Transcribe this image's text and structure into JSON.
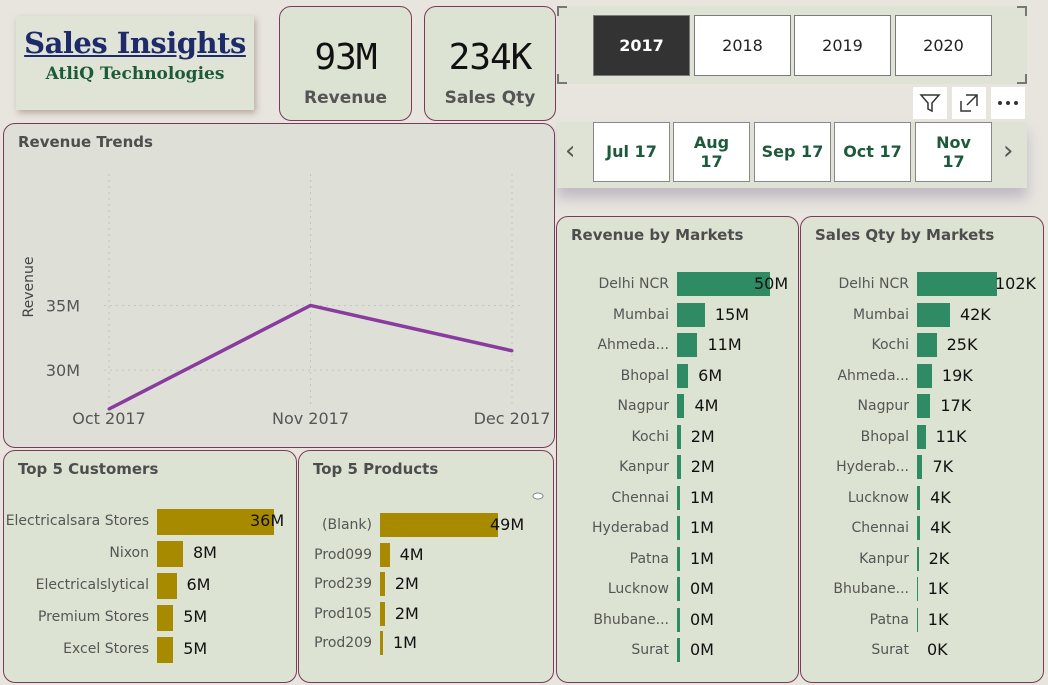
{
  "header": {
    "title": "Sales Insights",
    "subtitle": "AtliQ Technologies"
  },
  "kpis": [
    {
      "value": "93M",
      "label": "Revenue"
    },
    {
      "value": "234K",
      "label": "Sales Qty"
    }
  ],
  "year_slicer": {
    "options": [
      "2017",
      "2018",
      "2019",
      "2020"
    ],
    "selected": "2017"
  },
  "month_slicer": {
    "options": [
      "Jul 17",
      "Aug 17",
      "Sep 17",
      "Oct 17",
      "Nov 17"
    ]
  },
  "revenue_trends": {
    "title": "Revenue Trends",
    "chart_data": {
      "type": "line",
      "title": "Revenue Trends",
      "xlabel": "",
      "ylabel": "Revenue",
      "categories": [
        "Oct 2017",
        "Nov 2017",
        "Dec 2017"
      ],
      "values": [
        27,
        35,
        31.5
      ],
      "ytick_labels": [
        "35M",
        "30M"
      ],
      "ytick_values": [
        35,
        30
      ],
      "ylim": [
        27,
        35.5
      ],
      "grid": true,
      "color": "#8a3b9e"
    }
  },
  "top_customers": {
    "title": "Top 5 Customers",
    "chart_data": {
      "type": "bar",
      "categories": [
        "Electricalsara Stores",
        "Nixon",
        "Electricalslytical",
        "Premium Stores",
        "Excel Stores"
      ],
      "values": [
        36,
        8,
        6,
        5,
        5
      ],
      "labels": [
        "36M",
        "8M",
        "6M",
        "5M",
        "5M"
      ],
      "color": "#a88a00"
    }
  },
  "top_products": {
    "title": "Top 5 Products",
    "chart_data": {
      "type": "bar",
      "categories": [
        "(Blank)",
        "Prod099",
        "Prod239",
        "Prod105",
        "Prod209"
      ],
      "values": [
        49,
        4,
        2,
        2,
        1
      ],
      "labels": [
        "49M",
        "4M",
        "2M",
        "2M",
        "1M"
      ],
      "color": "#a88a00"
    }
  },
  "revenue_by_markets": {
    "title": "Revenue by Markets",
    "chart_data": {
      "type": "bar",
      "categories": [
        "Delhi NCR",
        "Mumbai",
        "Ahmeda...",
        "Bhopal",
        "Nagpur",
        "Kochi",
        "Kanpur",
        "Chennai",
        "Hyderabad",
        "Patna",
        "Lucknow",
        "Bhubane...",
        "Surat"
      ],
      "values": [
        50,
        15,
        11,
        6,
        4,
        2,
        2,
        1,
        1,
        1,
        0,
        0,
        0
      ],
      "labels": [
        "50M",
        "15M",
        "11M",
        "6M",
        "4M",
        "2M",
        "2M",
        "1M",
        "1M",
        "1M",
        "0M",
        "0M",
        "0M"
      ],
      "color": "#2e8b63"
    }
  },
  "sales_qty_by_markets": {
    "title": "Sales Qty by Markets",
    "chart_data": {
      "type": "bar",
      "categories": [
        "Delhi NCR",
        "Mumbai",
        "Kochi",
        "Ahmeda...",
        "Nagpur",
        "Bhopal",
        "Hyderab...",
        "Lucknow",
        "Chennai",
        "Kanpur",
        "Bhubane...",
        "Patna",
        "Surat"
      ],
      "values": [
        102,
        42,
        25,
        19,
        17,
        11,
        7,
        4,
        4,
        2,
        1,
        1,
        0
      ],
      "labels": [
        "102K",
        "42K",
        "25K",
        "19K",
        "17K",
        "11K",
        "7K",
        "4K",
        "4K",
        "2K",
        "1K",
        "1K",
        "0K"
      ],
      "color": "#2e8b63"
    }
  }
}
